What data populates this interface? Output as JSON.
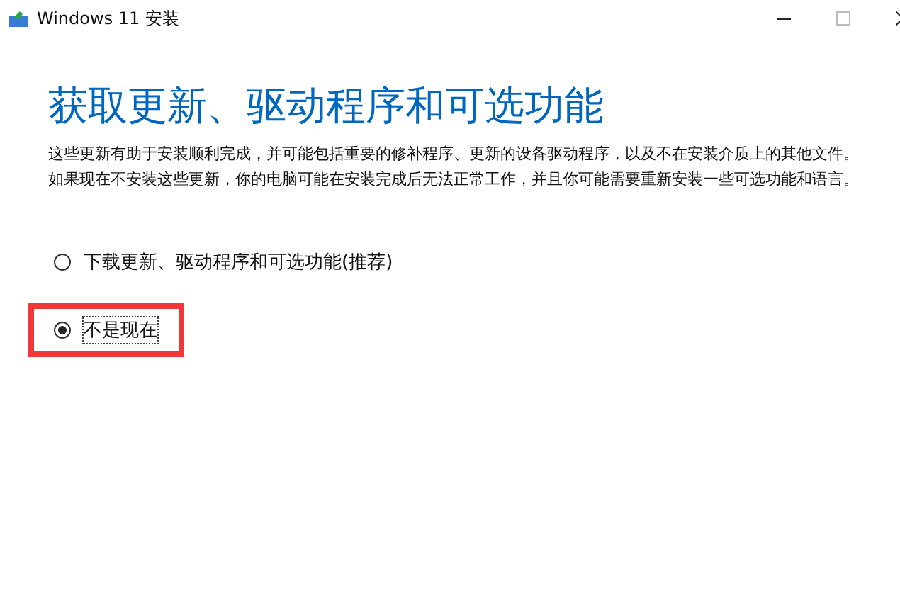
{
  "window": {
    "title": "Windows 11 安装"
  },
  "heading": "获取更新、驱动程序和可选功能",
  "description": "这些更新有助于安装顺利完成，并可能包括重要的修补程序、更新的设备驱动程序，以及不在安装介质上的其他文件。如果现在不安装这些更新，你的电脑可能在安装完成后无法正常工作，并且你可能需要重新安装一些可选功能和语言。",
  "options": [
    {
      "label": "下载更新、驱动程序和可选功能(推荐)",
      "selected": false,
      "highlighted": false
    },
    {
      "label": "不是现在",
      "selected": true,
      "highlighted": true
    }
  ]
}
